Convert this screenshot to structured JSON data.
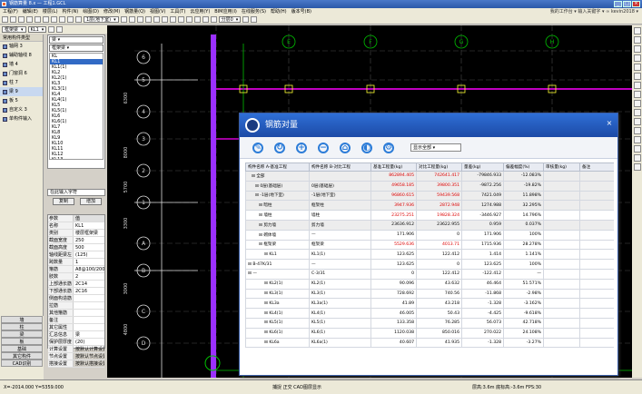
{
  "window": {
    "title": "钢筋算量 8.x — 工程1.GCL"
  },
  "menu": [
    "工程(F)",
    "编辑(E)",
    "楼层(L)",
    "构件(N)",
    "绘图(D)",
    "修改(M)",
    "钢筋量(Q)",
    "视图(V)",
    "工具(T)",
    "云应用(Y)",
    "BIM应用(I)",
    "在线服务(S)",
    "帮助(H)",
    "版本号(B)"
  ],
  "menu_right": "我的工作台 ▾ 输入关键字 ▾ ∞ kevin2018 ▾",
  "toolbar": {
    "floor_select": "1层(地下室)",
    "element_select": "框架梁",
    "layer_select": "分层0",
    "sub_select": "KL1"
  },
  "leftnav": {
    "header": "常用构件类型",
    "items": [
      {
        "label": "轴网 3"
      },
      {
        "label": "辅助轴线 8"
      },
      {
        "label": "墙 4"
      },
      {
        "label": "门窗洞 6"
      },
      {
        "label": "柱 7"
      },
      {
        "label": "梁 9"
      },
      {
        "label": "板 5"
      },
      {
        "label": "自定义 3"
      },
      {
        "label": "单构件输入"
      }
    ],
    "bottom": [
      "墙",
      "柱",
      "梁",
      "板",
      "基础",
      "其它构件",
      "CAD识别"
    ]
  },
  "complist": {
    "type_select": "梁",
    "filter_select": "框架梁",
    "items": [
      "KL",
      "KL1",
      "KL1(1)",
      "KL2",
      "KL2(1)",
      "KL3",
      "KL3(1)",
      "KL4",
      "KL4(1)",
      "KL5",
      "KL5(1)",
      "KL6",
      "KL6(1)",
      "KL7",
      "KL8",
      "KL9",
      "KL10",
      "KL11",
      "KL12",
      "KL13",
      "KL14",
      "KL15(1)",
      "KL16",
      "KL17"
    ],
    "active_index": 1,
    "search_placeholder": "在此输入字符",
    "copy_label": "复制",
    "add_label": "增加"
  },
  "props": {
    "header": [
      "参数",
      "值"
    ],
    "rows": [
      [
        "名称",
        "KL1"
      ],
      [
        "类别",
        "楼层框架梁"
      ],
      [
        "截面宽度",
        "250"
      ],
      [
        "截面高度",
        "500"
      ],
      [
        "轴线距梁左",
        "(125)"
      ],
      [
        "跨数量",
        "1"
      ],
      [
        "箍筋",
        "A8@100/200(2)"
      ],
      [
        "肢数",
        "2"
      ],
      [
        "上部通长筋",
        "2C14"
      ],
      [
        "下部通长筋",
        "2C16"
      ],
      [
        "侧面构造筋",
        ""
      ],
      [
        "拉筋",
        ""
      ],
      [
        "其他箍筋",
        ""
      ],
      [
        "备注",
        ""
      ],
      [
        "其它属性",
        ""
      ],
      [
        "汇总信息",
        "梁"
      ],
      [
        "保护层厚度",
        "(20)"
      ],
      [
        "计算设置",
        "按默认计算设置"
      ],
      [
        "节点设置",
        "按默认节点设置"
      ],
      [
        "搭接设置",
        "按默认搭接设置"
      ]
    ]
  },
  "cad": {
    "axis_labels": [
      "6",
      "5",
      "4",
      "3",
      "2",
      "1",
      "A",
      "B",
      "C",
      "D",
      "E",
      "F",
      "G",
      "H"
    ],
    "dims": [
      "6300",
      "8000",
      "5700",
      "3300",
      "3000",
      "4800"
    ]
  },
  "statusbar": {
    "left": "X=-2014.000  Y=5359.000",
    "mid": "捕捉  正交  CAD图层显示",
    "right": "层高:3.6m  底标高:-3.6m  FPS:30"
  },
  "dialog": {
    "title": "钢筋对量",
    "toolbar_icons": [
      "wrench-icon",
      "refresh-icon",
      "expand-icon",
      "collapse-icon",
      "export-icon",
      "contrast-icon",
      "settings-icon"
    ],
    "select": "显示全部",
    "columns": [
      "构件名称 A-基准工程",
      "构件名称 B-对比工程",
      "基准工程量(kg)",
      "对比工程量(kg)",
      "量差(kg)",
      "偏差幅度(%)",
      "审核量(kg)",
      "备注"
    ],
    "rows": [
      [
        "全部",
        "",
        "862894.405",
        "742641.417",
        "-79846.933",
        "-12.083%",
        "",
        ""
      ],
      [
        "0层(基础层)",
        "0层(基础层)",
        "49658.185",
        "39800.351",
        "-9872.256",
        "-19.82%",
        "",
        ""
      ],
      [
        "-1层(地下室)",
        "-1层(地下室)",
        "96860.615",
        "59439.568",
        "7421.049",
        "11.898%",
        "",
        ""
      ],
      [
        "暗柱",
        "框架柱",
        "3947.936",
        "2872.948",
        "1274.988",
        "32.295%",
        "",
        ""
      ],
      [
        "墙柱",
        "墙柱",
        "23275.251",
        "19828.324",
        "-3446.927",
        "14.796%",
        "",
        ""
      ],
      [
        "剪力墙",
        "剪力墙",
        "23636.912",
        "23622.955",
        "0.959",
        "0.037%",
        "",
        ""
      ],
      [
        "砌体墙",
        "—",
        "171.906",
        "0",
        "171.906",
        "100%",
        "",
        ""
      ],
      [
        "框架梁",
        "框架梁",
        "5529.636",
        "4013.71",
        "1715.936",
        "28.278%",
        "",
        ""
      ],
      [
        "KL1",
        "KL1(1)",
        "123.625",
        "122.412",
        "1.414",
        "1.141%",
        "",
        ""
      ],
      [
        "B-47K/31",
        "—",
        "123.625",
        "0",
        "123.625",
        "100%",
        "",
        ""
      ],
      [
        "—",
        "C-3/31",
        "0",
        "122.412",
        "-122.412",
        "—",
        "",
        ""
      ],
      [
        "KL2(1)",
        "KL2(1)",
        "90.096",
        "43.632",
        "46.464",
        "51.571%",
        "",
        ""
      ],
      [
        "KL3(1)",
        "KL3(1)",
        "728.692",
        "740.56",
        "-11.868",
        "-2.98%",
        "",
        ""
      ],
      [
        "KL3a",
        "KL3a(1)",
        "41.89",
        "43.218",
        "-1.328",
        "-3.162%",
        "",
        ""
      ],
      [
        "KL4(1)",
        "KL4(1)",
        "46.005",
        "50.43",
        "-4.425",
        "-9.618%",
        "",
        ""
      ],
      [
        "KL5(1)",
        "KL5(1)",
        "133.358",
        "76.285",
        "56.073",
        "42.718%",
        "",
        ""
      ],
      [
        "KL6(1)",
        "KL6(1)",
        "1120.038",
        "850.016",
        "270.022",
        "24.108%",
        "",
        ""
      ],
      [
        "KL6a",
        "KL6a(1)",
        "40.607",
        "41.935",
        "-1.328",
        "-3.27%",
        "",
        ""
      ]
    ],
    "row_meta": [
      [
        1,
        1
      ],
      [
        1,
        2
      ],
      [
        1,
        2
      ],
      [
        1,
        3
      ],
      [
        0,
        3
      ],
      [
        1,
        3
      ],
      [
        0,
        3
      ],
      [
        0,
        3
      ],
      [
        0,
        4
      ],
      [
        0,
        5
      ],
      [
        0,
        5
      ],
      [
        0,
        4
      ],
      [
        0,
        4
      ],
      [
        0,
        4
      ],
      [
        0,
        4
      ],
      [
        0,
        4
      ],
      [
        0,
        4
      ],
      [
        0,
        4
      ]
    ],
    "red_rows": [
      0,
      1,
      2,
      3,
      4,
      7
    ]
  },
  "colors": {
    "titlebar": "#2b58a8",
    "cad_bg": "#000000",
    "purple_axis": "#9b30ff",
    "green_axis": "#00c000",
    "magenta": "#ff00ff"
  }
}
